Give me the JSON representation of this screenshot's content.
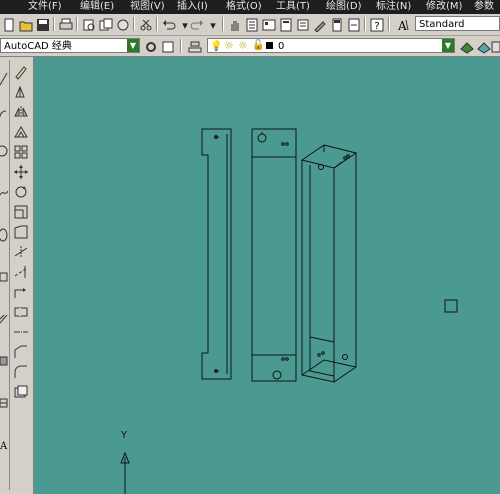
{
  "menu": {
    "items": [
      "文件(F)",
      "编辑(E)",
      "视图(V)",
      "插入(I)",
      "格式(O)",
      "工具(T)",
      "绘图(D)",
      "标注(N)",
      "修改(M)",
      "参数"
    ]
  },
  "toolbar": {
    "text_style": "Standard",
    "workspace": "AutoCAD 经典",
    "layer": "0"
  },
  "canvas": {
    "background": "#4a9a92",
    "ucs_y_label": "Y"
  },
  "colors": {
    "menubar": "#1e1e1e",
    "toolbar": "#d4d0c8",
    "drawing_lines": "#111111"
  }
}
